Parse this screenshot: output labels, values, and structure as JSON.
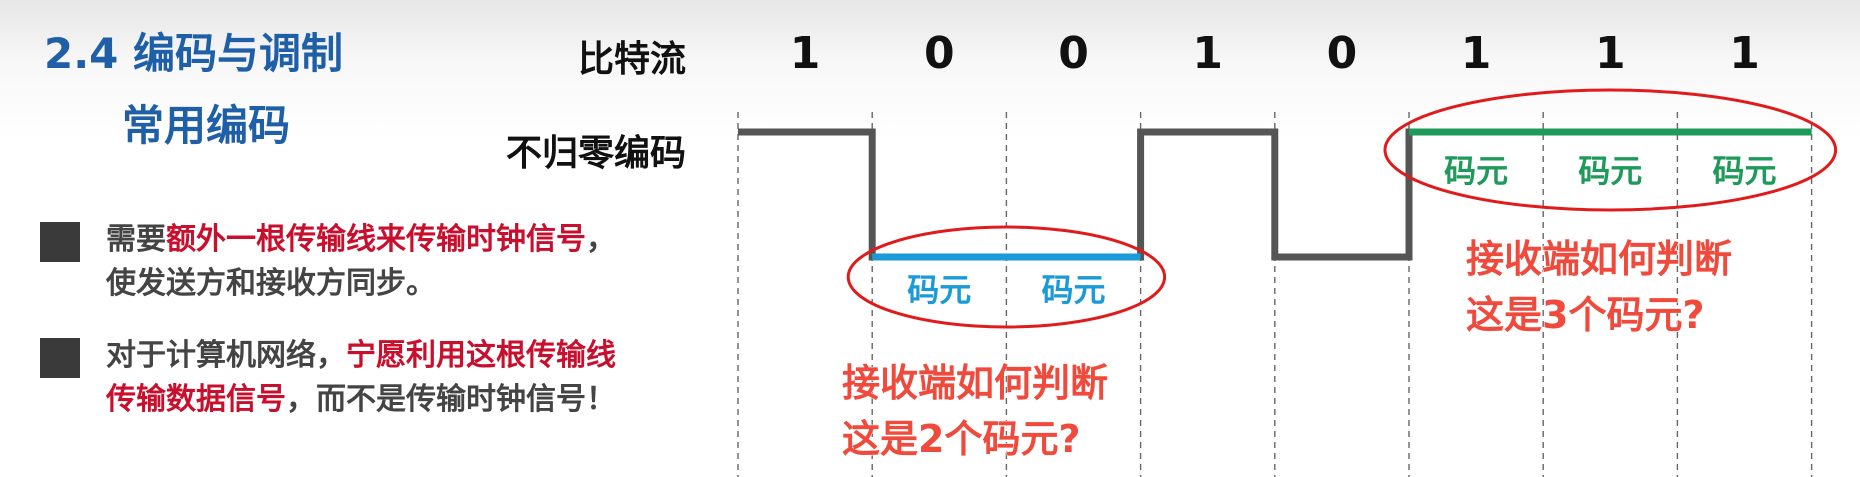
{
  "title": {
    "main": "2.4 编码与调制",
    "sub": "常用编码"
  },
  "bullets": [
    {
      "parts": [
        {
          "text": "需要",
          "highlight": false
        },
        {
          "text": "额外一根传输线来传输时钟信号",
          "highlight": true
        },
        {
          "text": "，",
          "highlight": false
        }
      ],
      "line2": "使发送方和接收方同步。"
    },
    {
      "parts": [
        {
          "text": "对于计算机网络，",
          "highlight": false
        },
        {
          "text": "宁愿利用这根传输线",
          "highlight": true
        }
      ],
      "line2_parts": [
        {
          "text": "传输数据信号",
          "highlight": true
        },
        {
          "text": "，而不是传输时钟信号！",
          "highlight": false
        }
      ]
    }
  ],
  "diagram": {
    "bitstream_label": "比特流",
    "nrz_label": "不归零编码",
    "bits": [
      "1",
      "0",
      "0",
      "1",
      "0",
      "1",
      "1",
      "1"
    ],
    "symbol_label": "码元",
    "question_two": {
      "line1": "接收端如何判断",
      "line2": "这是2个码元?"
    },
    "question_three": {
      "line1": "接收端如何判断",
      "line2": "这是3个码元?"
    }
  },
  "colors": {
    "title": "#1f5fa8",
    "highlight": "#c8102e",
    "question": "#f04a3c",
    "ellipse": "#e01b1b",
    "low_symbol": "#1a9ad6",
    "high_symbol": "#1f9a5a",
    "waveform": "#555555"
  }
}
